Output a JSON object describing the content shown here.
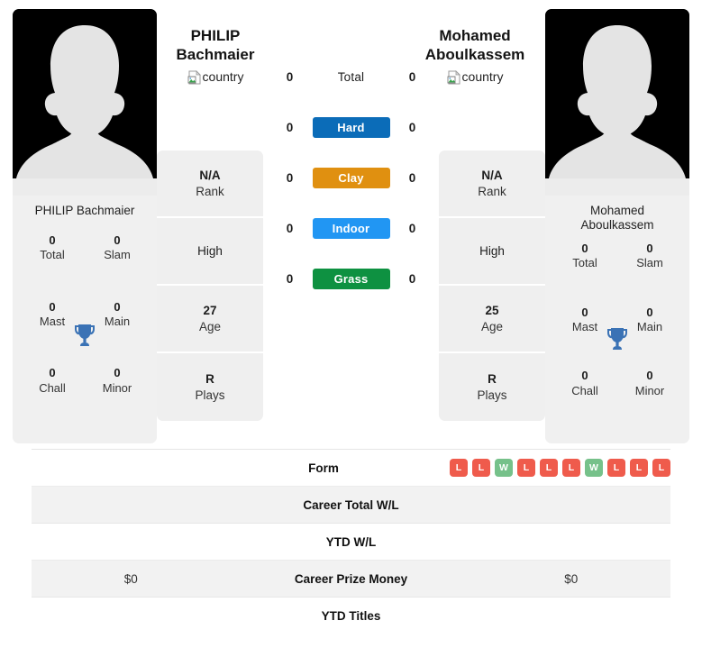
{
  "players": {
    "left": {
      "first_name": "PHILIP",
      "last_name": "Bachmaier",
      "card_name": "PHILIP Bachmaier",
      "country_alt": "country",
      "avatar_alt": "player-photo",
      "titles": [
        {
          "value": "0",
          "label": "Total"
        },
        {
          "value": "0",
          "label": "Slam"
        },
        {
          "value": "0",
          "label": "Mast"
        },
        {
          "value": "0",
          "label": "Main"
        },
        {
          "value": "0",
          "label": "Chall"
        },
        {
          "value": "0",
          "label": "Minor"
        }
      ],
      "info": [
        {
          "value": "N/A",
          "caption": "Rank"
        },
        {
          "value": "High",
          "caption": ""
        },
        {
          "value": "27",
          "caption": "Age"
        },
        {
          "value": "R",
          "caption": "Plays"
        }
      ]
    },
    "right": {
      "first_name": "Mohamed",
      "last_name": "Aboulkassem",
      "card_name_line1": "Mohamed",
      "card_name_line2": "Aboulkassem",
      "country_alt": "country",
      "avatar_alt": "player-photo",
      "titles": [
        {
          "value": "0",
          "label": "Total"
        },
        {
          "value": "0",
          "label": "Slam"
        },
        {
          "value": "0",
          "label": "Mast"
        },
        {
          "value": "0",
          "label": "Main"
        },
        {
          "value": "0",
          "label": "Chall"
        },
        {
          "value": "0",
          "label": "Minor"
        }
      ],
      "info": [
        {
          "value": "N/A",
          "caption": "Rank"
        },
        {
          "value": "High",
          "caption": ""
        },
        {
          "value": "25",
          "caption": "Age"
        },
        {
          "value": "R",
          "caption": "Plays"
        }
      ]
    }
  },
  "head_to_head": [
    {
      "label": "Total",
      "left": "0",
      "right": "0",
      "color": "transparent"
    },
    {
      "label": "Hard",
      "left": "0",
      "right": "0",
      "color": "#0b6cb8"
    },
    {
      "label": "Clay",
      "left": "0",
      "right": "0",
      "color": "#e09010"
    },
    {
      "label": "Indoor",
      "left": "0",
      "right": "0",
      "color": "#2196f3"
    },
    {
      "label": "Grass",
      "left": "0",
      "right": "0",
      "color": "#0e9141"
    }
  ],
  "stats_rows": [
    {
      "label": "Form",
      "left": "",
      "right": "",
      "type": "form"
    },
    {
      "label": "Career Total W/L",
      "left": "",
      "right": "",
      "type": "text"
    },
    {
      "label": "YTD W/L",
      "left": "",
      "right": "",
      "type": "text"
    },
    {
      "label": "Career Prize Money",
      "left": "$0",
      "right": "$0",
      "type": "text"
    },
    {
      "label": "YTD Titles",
      "left": "",
      "right": "",
      "type": "text"
    }
  ],
  "form": {
    "results": [
      "L",
      "L",
      "W",
      "L",
      "L",
      "L",
      "W",
      "L",
      "L",
      "L"
    ],
    "win_color": "#76c18a",
    "loss_color": "#ef5b4c"
  },
  "icons": {
    "trophy": "trophy-icon",
    "broken_image": "broken-image-icon"
  },
  "colors": {
    "trophy_blue": "#3a72b5",
    "card_bg": "#f0f0f0",
    "row_alt": "#f2f2f2"
  }
}
